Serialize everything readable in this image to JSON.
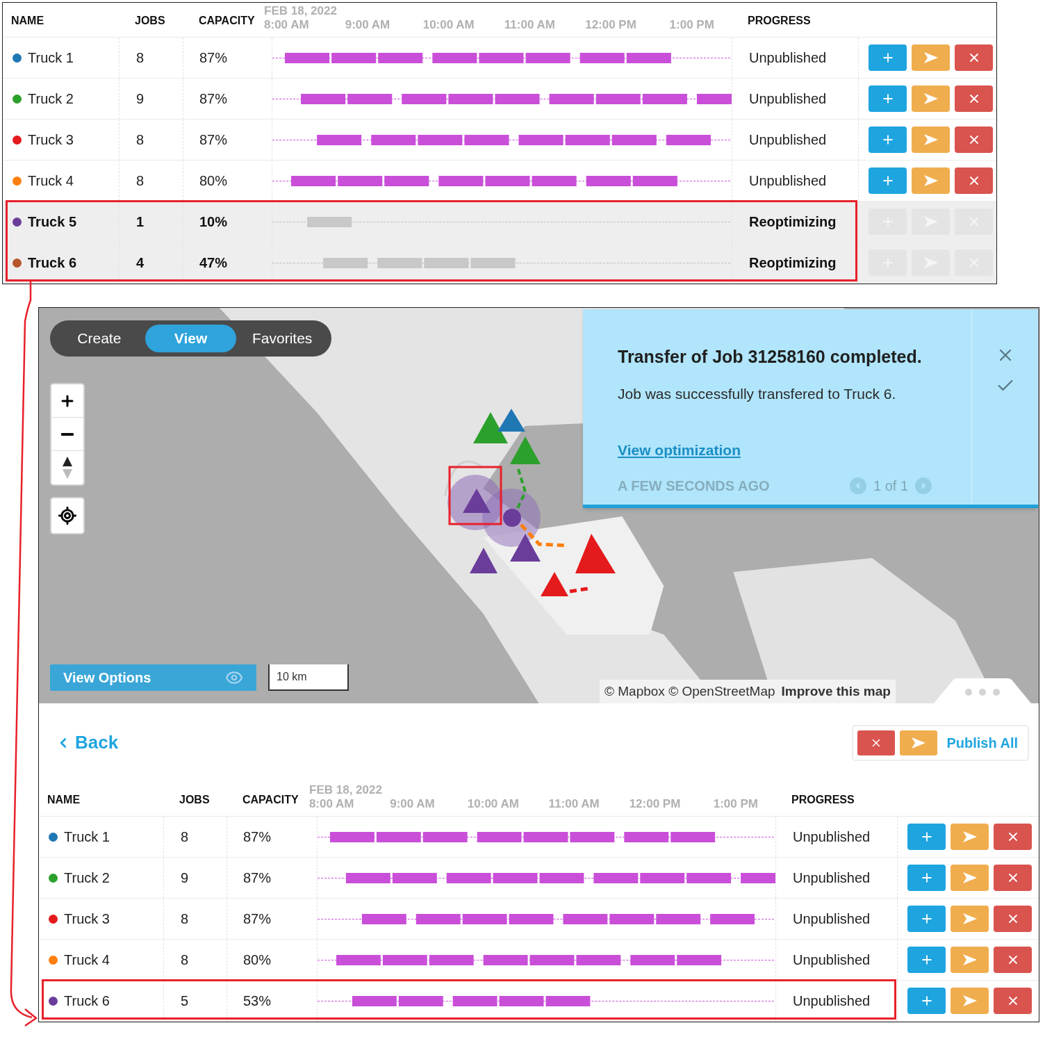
{
  "top_table": {
    "columns": [
      "NAME",
      "JOBS",
      "CAPACITY",
      "PROGRESS"
    ],
    "date": "FEB 18, 2022",
    "times": [
      "8:00 AM",
      "9:00 AM",
      "10:00 AM",
      "11:00 AM",
      "12:00 PM",
      "1:00 PM"
    ],
    "rows": [
      {
        "name": "Truck 1",
        "color": "#1f77b4",
        "jobs": "8",
        "capacity": "87%",
        "progress": "Unpublished",
        "disabled": false,
        "highlighted": false
      },
      {
        "name": "Truck 2",
        "color": "#2ca02c",
        "jobs": "9",
        "capacity": "87%",
        "progress": "Unpublished",
        "disabled": false,
        "highlighted": false
      },
      {
        "name": "Truck 3",
        "color": "#e41a1c",
        "jobs": "8",
        "capacity": "87%",
        "progress": "Unpublished",
        "disabled": false,
        "highlighted": false
      },
      {
        "name": "Truck 4",
        "color": "#ff7f0e",
        "jobs": "8",
        "capacity": "80%",
        "progress": "Unpublished",
        "disabled": false,
        "highlighted": false
      },
      {
        "name": "Truck 5",
        "color": "#6a3d9a",
        "jobs": "1",
        "capacity": "10%",
        "progress": "Reoptimizing",
        "disabled": true,
        "highlighted": true
      },
      {
        "name": "Truck 6",
        "color": "#b5562b",
        "jobs": "4",
        "capacity": "47%",
        "progress": "Reoptimizing",
        "disabled": true,
        "highlighted": true
      }
    ]
  },
  "map": {
    "modes": [
      {
        "label": "Create",
        "selected": false
      },
      {
        "label": "View",
        "selected": true
      },
      {
        "label": "Favorites",
        "selected": false
      }
    ],
    "view_options": "View Options",
    "scale": "10 km",
    "attribution": "© Mapbox © OpenStreetMap",
    "improve_link": "Improve this map"
  },
  "notification": {
    "title": "Transfer of Job 31258160 completed.",
    "message": "Job was successfully transfered to Truck 6.",
    "link": "View optimization",
    "time": "A FEW SECONDS AGO",
    "pager": "1 of 1"
  },
  "toolbar": {
    "back": "Back",
    "publish": "Publish All"
  },
  "bottom_table": {
    "columns": [
      "NAME",
      "JOBS",
      "CAPACITY",
      "PROGRESS"
    ],
    "date": "FEB 18, 2022",
    "times": [
      "8:00 AM",
      "9:00 AM",
      "10:00 AM",
      "11:00 AM",
      "12:00 PM",
      "1:00 PM"
    ],
    "rows": [
      {
        "name": "Truck 1",
        "color": "#1f77b4",
        "jobs": "8",
        "capacity": "87%",
        "progress": "Unpublished",
        "disabled": false,
        "highlighted": false
      },
      {
        "name": "Truck 2",
        "color": "#2ca02c",
        "jobs": "9",
        "capacity": "87%",
        "progress": "Unpublished",
        "disabled": false,
        "highlighted": false
      },
      {
        "name": "Truck 3",
        "color": "#e41a1c",
        "jobs": "8",
        "capacity": "87%",
        "progress": "Unpublished",
        "disabled": false,
        "highlighted": false
      },
      {
        "name": "Truck 4",
        "color": "#ff7f0e",
        "jobs": "8",
        "capacity": "80%",
        "progress": "Unpublished",
        "disabled": false,
        "highlighted": false
      },
      {
        "name": "Truck 6",
        "color": "#6a3d9a",
        "jobs": "5",
        "capacity": "53%",
        "progress": "Unpublished",
        "disabled": false,
        "highlighted": true
      }
    ]
  }
}
